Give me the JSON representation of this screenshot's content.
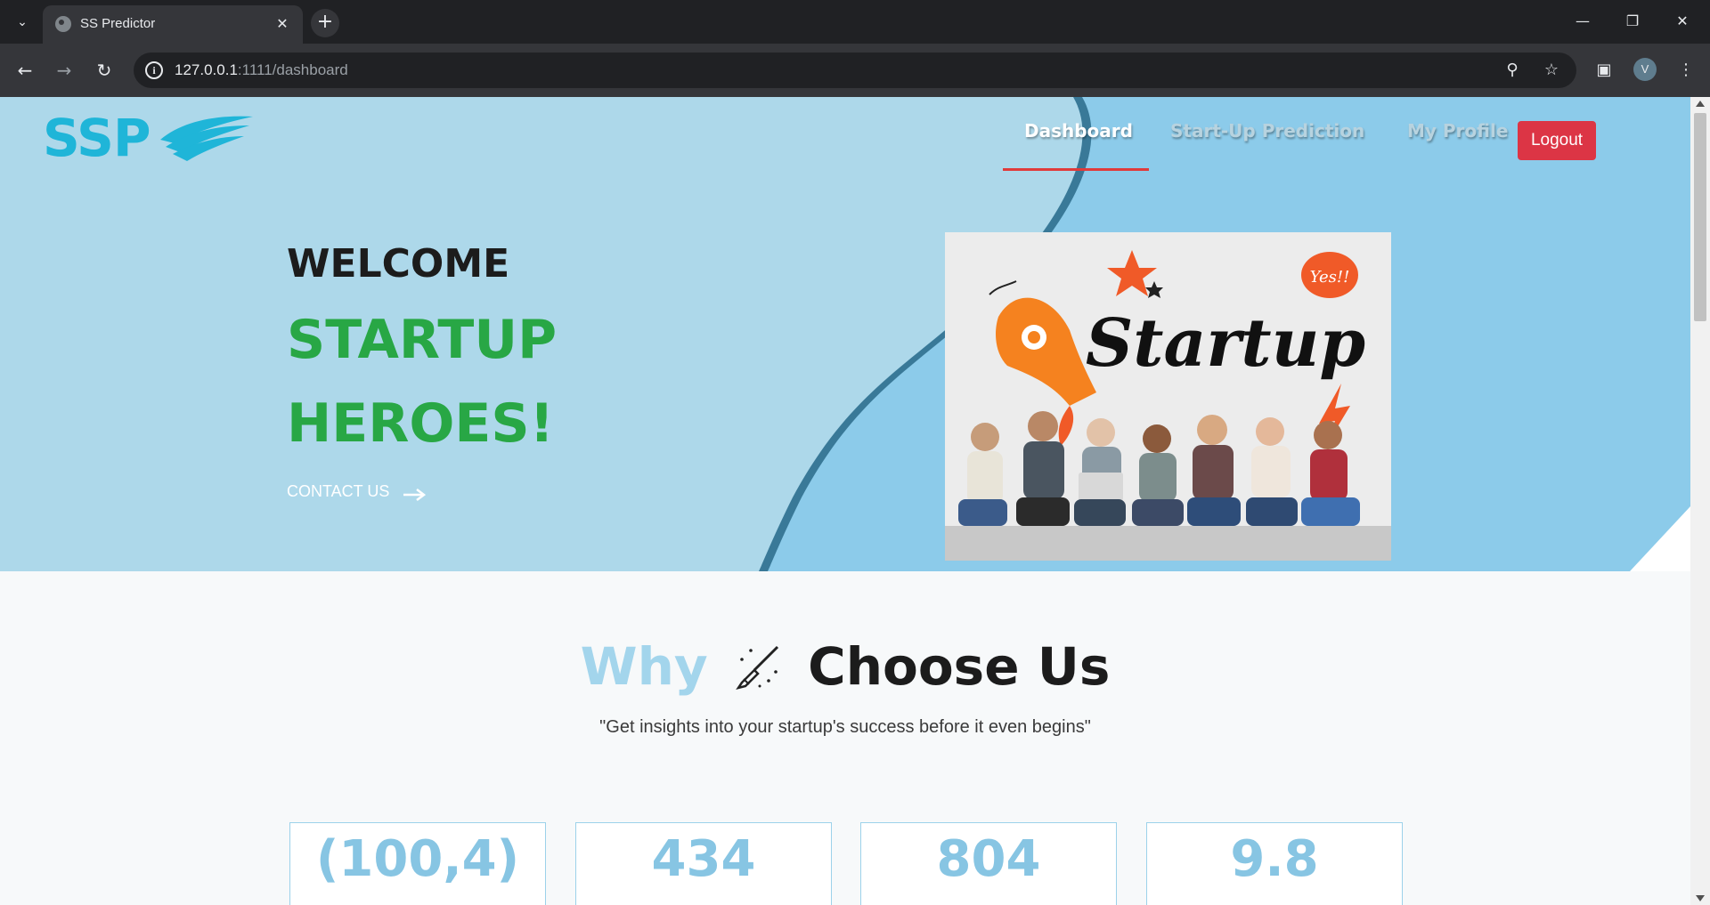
{
  "browser": {
    "tab_title": "SS Predictor",
    "url_host": "127.0.0.1",
    "url_rest": ":1111/dashboard",
    "profile_initial": "V"
  },
  "site": {
    "logo_text": "SSP",
    "nav": [
      "Dashboard",
      "Start-Up Prediction",
      "My Profile"
    ],
    "active_nav": "Dashboard",
    "logout_label": "Logout"
  },
  "hero": {
    "welcome": "WELCOME",
    "line1": "STARTUP",
    "line2": "HEROES!",
    "contact_label": "CONTACT US",
    "image_word": "Startup",
    "image_bubble": "Yes!!"
  },
  "why": {
    "word1": "Why",
    "word2": "Choose Us",
    "tagline": "\"Get insights into your startup's success before it even begins\""
  },
  "stats": [
    "(100,4)",
    "434",
    "804",
    "9.8"
  ],
  "colors": {
    "hero_bg": "#add8ea",
    "accent_green": "#28a745",
    "logout_red": "#dc3545",
    "logo_blue": "#1fb5d8",
    "stat_blue": "#87c5e3"
  }
}
